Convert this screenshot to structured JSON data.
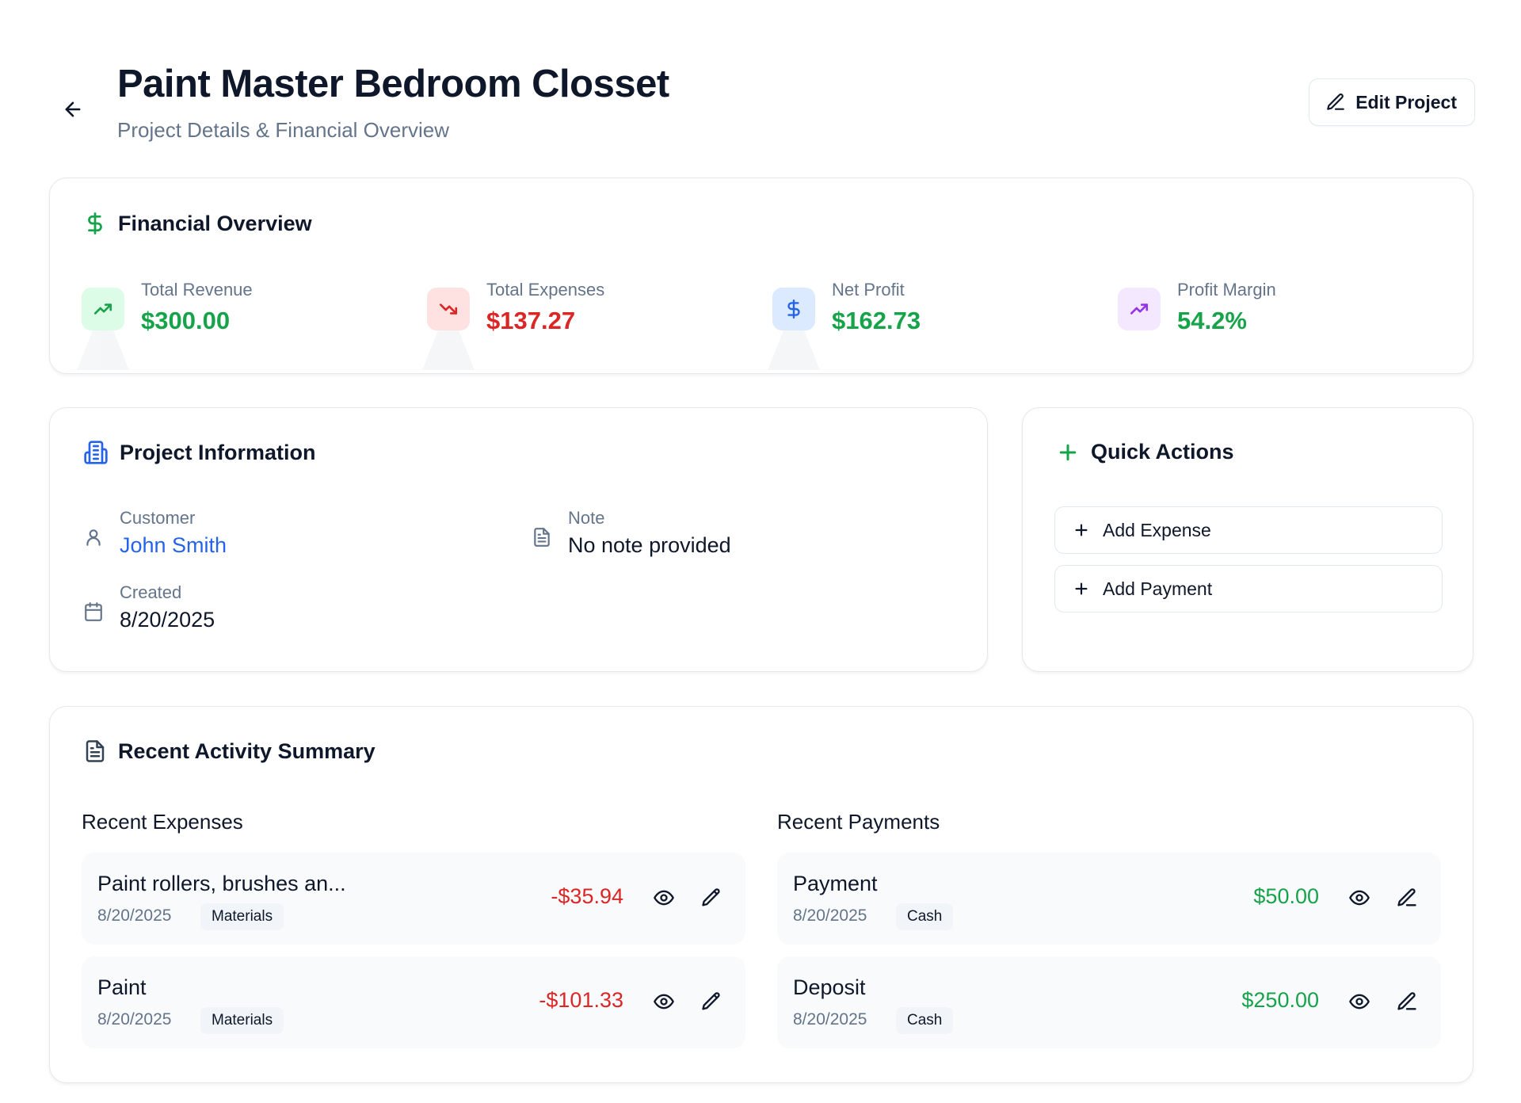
{
  "header": {
    "title": "Paint Master Bedroom Closset",
    "subtitle": "Project Details & Financial Overview",
    "edit_label": "Edit Project"
  },
  "financial": {
    "title": "Financial Overview",
    "stats": [
      {
        "label": "Total Revenue",
        "value": "$300.00",
        "color": "#16a34a",
        "icon": "trending-up-icon"
      },
      {
        "label": "Total Expenses",
        "value": "$137.27",
        "color": "#dc2626",
        "icon": "trending-down-icon"
      },
      {
        "label": "Net Profit",
        "value": "$162.73",
        "color": "#16a34a",
        "icon": "dollar-icon"
      },
      {
        "label": "Profit Margin",
        "value": "54.2%",
        "color": "#16a34a",
        "icon": "trending-up-icon"
      }
    ]
  },
  "project_info": {
    "title": "Project Information",
    "customer_label": "Customer",
    "customer_value": "John Smith",
    "note_label": "Note",
    "note_value": "No note provided",
    "created_label": "Created",
    "created_value": "8/20/2025"
  },
  "quick_actions": {
    "title": "Quick Actions",
    "add_expense": "Add Expense",
    "add_payment": "Add Payment"
  },
  "activity": {
    "title": "Recent Activity Summary",
    "expenses_title": "Recent Expenses",
    "payments_title": "Recent Payments",
    "expenses": [
      {
        "title": "Paint rollers, brushes an...",
        "date": "8/20/2025",
        "tag": "Materials",
        "amount": "-$35.94"
      },
      {
        "title": "Paint",
        "date": "8/20/2025",
        "tag": "Materials",
        "amount": "-$101.33"
      }
    ],
    "payments": [
      {
        "title": "Payment",
        "date": "8/20/2025",
        "tag": "Cash",
        "amount": "$50.00"
      },
      {
        "title": "Deposit",
        "date": "8/20/2025",
        "tag": "Cash",
        "amount": "$250.00"
      }
    ]
  },
  "colors": {
    "green": "#16a34a",
    "red": "#dc2626",
    "blue": "#2563eb",
    "purple": "#9333ea"
  }
}
